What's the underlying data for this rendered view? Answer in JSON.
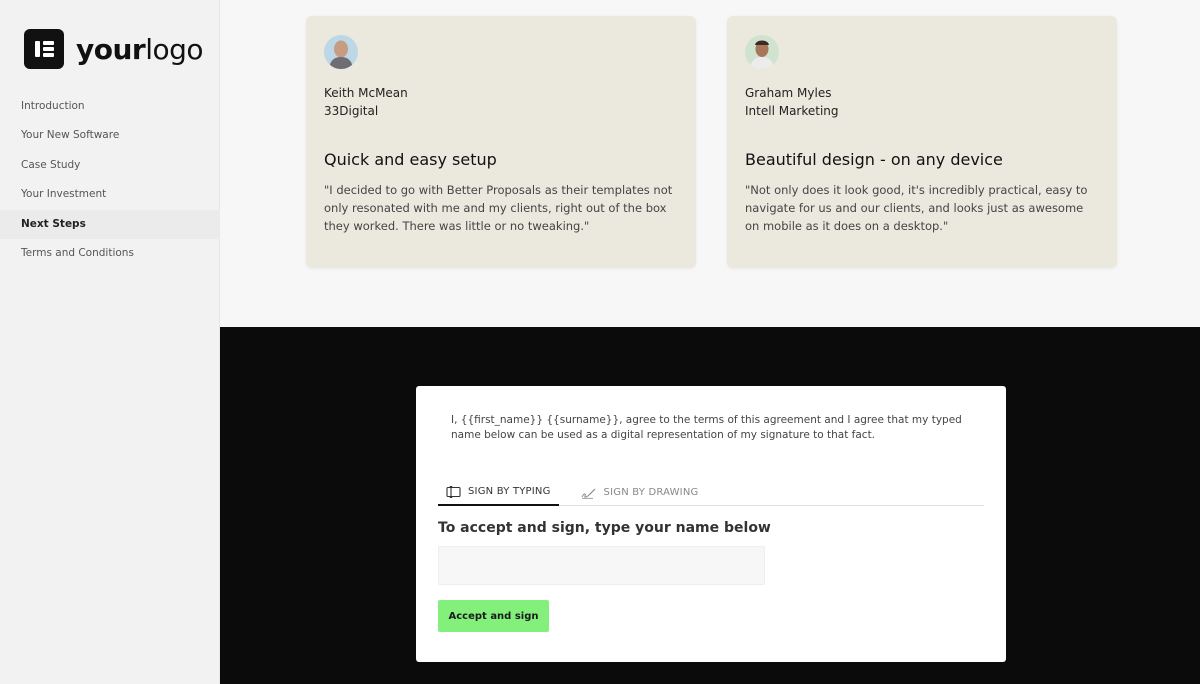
{
  "sidebar": {
    "logo": {
      "bold": "your",
      "light": "logo",
      "icon": "logo-mark-icon"
    },
    "items": [
      {
        "label": "Introduction"
      },
      {
        "label": "Your New Software"
      },
      {
        "label": "Case Study"
      },
      {
        "label": "Your Investment"
      },
      {
        "label": "Next Steps",
        "active": true
      },
      {
        "label": "Terms and Conditions"
      }
    ]
  },
  "testimonials": [
    {
      "name": "Keith McMean",
      "company": "33Digital",
      "title": "Quick and easy setup",
      "quote": "\"I decided to go with Better Proposals as their templates not only resonated with me and my clients, right out of the box they worked. There was little or no tweaking.\""
    },
    {
      "name": "Graham Myles",
      "company": "Intell Marketing",
      "title": "Beautiful design - on any device",
      "quote": "\"Not only does it look good, it's incredibly practical, easy to navigate for us and our clients, and looks just as awesome on mobile as it does on a desktop.\""
    }
  ],
  "signature": {
    "agreement": "I, {{first_name}} {{surname}}, agree to the terms of this agreement and I agree that my typed name below can be used as a digital representation of my signature to that fact.",
    "tabs": [
      {
        "label": "SIGN BY TYPING",
        "icon": "keyboard-icon",
        "active": true
      },
      {
        "label": "SIGN BY DRAWING",
        "icon": "signature-pen-icon",
        "active": false
      }
    ],
    "prompt": "To accept and sign, type your name below",
    "input_value": "",
    "button_label": "Accept and sign"
  },
  "colors": {
    "accent_button": "#83f07c",
    "card_bg": "#ebe8de",
    "dark_bg": "#0b0b0b"
  }
}
